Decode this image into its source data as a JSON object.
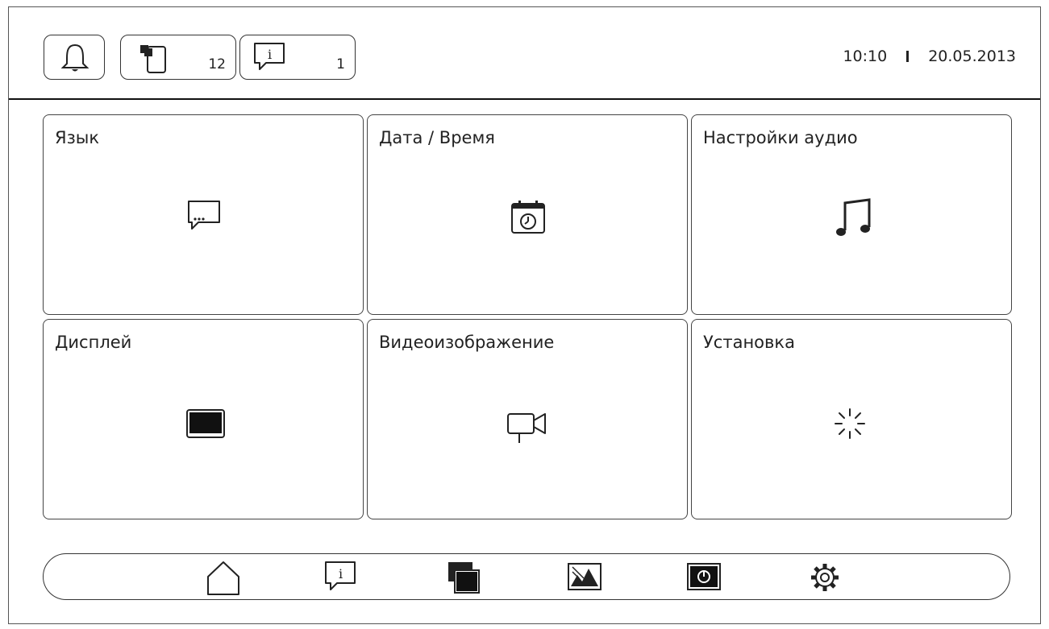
{
  "header": {
    "bell_icon": "bell-icon",
    "messages": {
      "icon": "message-stack-icon",
      "count": "12"
    },
    "info": {
      "icon": "info-bubble-icon",
      "count": "1"
    },
    "time": "10:10",
    "date": "20.05.2013"
  },
  "tiles": [
    {
      "label": "Язык",
      "icon": "speech-bubble-icon"
    },
    {
      "label": "Дата / Время",
      "icon": "calendar-clock-icon"
    },
    {
      "label": "Настройки аудио",
      "icon": "music-note-icon"
    },
    {
      "label": "Дисплей",
      "icon": "monitor-icon"
    },
    {
      "label": "Видеоизображение",
      "icon": "video-camera-icon"
    },
    {
      "label": "Установка",
      "icon": "loading-spinner-icon"
    }
  ],
  "navbar": {
    "items": [
      "home-icon",
      "info-bubble-icon",
      "windows-icon",
      "picture-icon",
      "power-screen-icon",
      "gear-icon"
    ]
  }
}
